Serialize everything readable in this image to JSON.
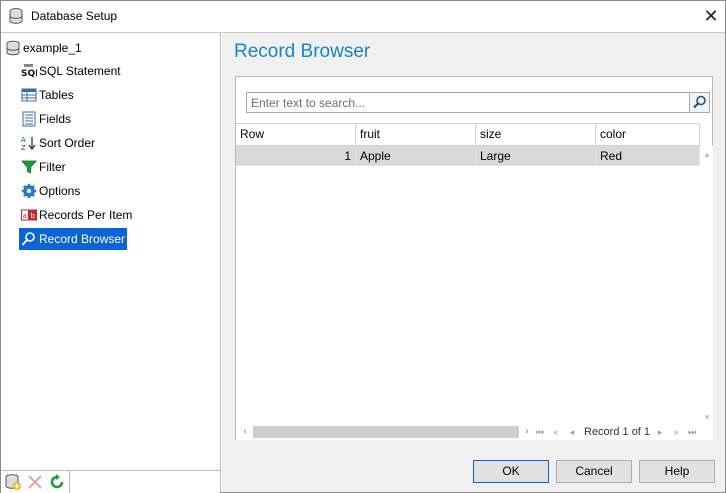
{
  "window": {
    "title": "Database Setup",
    "close_glyph": "✕"
  },
  "tree": {
    "root": {
      "label": "example_1",
      "icon": "database-icon"
    },
    "items": [
      {
        "label": "SQL Statement",
        "icon": "sql-icon"
      },
      {
        "label": "Tables",
        "icon": "table-icon"
      },
      {
        "label": "Fields",
        "icon": "fields-icon"
      },
      {
        "label": "Sort Order",
        "icon": "sort-az-icon"
      },
      {
        "label": "Filter",
        "icon": "funnel-icon"
      },
      {
        "label": "Options",
        "icon": "gear-icon"
      },
      {
        "label": "Records Per Item",
        "icon": "records-per-item-icon"
      },
      {
        "label": "Record Browser",
        "icon": "record-browser-icon",
        "selected": true
      }
    ]
  },
  "left_toolbar": [
    "add-database-icon",
    "delete-icon",
    "refresh-icon"
  ],
  "panel": {
    "title": "Record Browser",
    "search_placeholder": "Enter text to search...",
    "columns": [
      "Row",
      "fruit",
      "size",
      "color"
    ],
    "rows": [
      {
        "row": "1",
        "fruit": "Apple",
        "size": "Large",
        "color": "Red"
      }
    ],
    "record_status": "Record 1 of 1"
  },
  "buttons": {
    "ok": "OK",
    "cancel": "Cancel",
    "help": "Help"
  },
  "colors": {
    "accent": "#1a83c6",
    "selection": "#0a64d6",
    "row_highlight": "#d9d9d9"
  }
}
